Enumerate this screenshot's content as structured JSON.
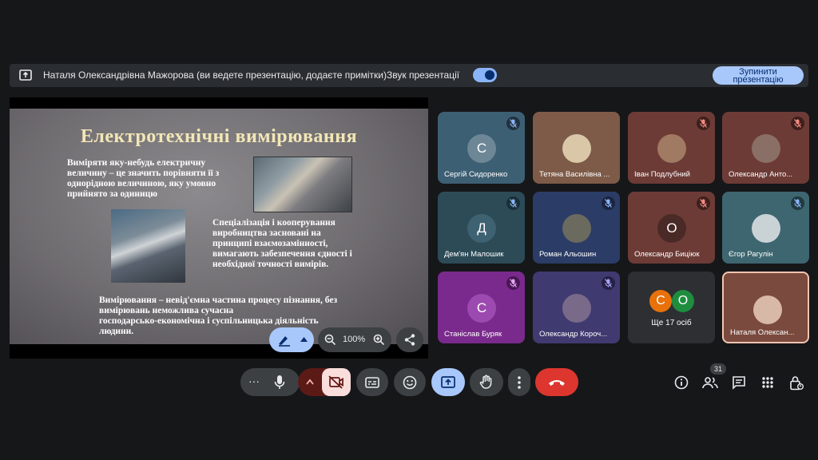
{
  "presenting_bar": {
    "text": "Наталя Олександрівна Мажорова (ви ведете презентацію, додаєте примітки)",
    "audio_label": "Звук презентації",
    "stop_line1": "Зупинити",
    "stop_line2": "презентацію"
  },
  "slide": {
    "title": "Електротехнічні вимірювання",
    "p1": [
      "Виміряти яку-небудь електричну",
      "величину – це значить порівняти її з",
      "однорідною величиною, яку умовно",
      "прийнято за одиницю"
    ],
    "p2": [
      "Спеціалізація і кооперування",
      "виробництва засновані на",
      "принципі взаємозамінності,",
      "вимагають забезпечення єдності і",
      "необхідної точності вимірів."
    ],
    "p3": [
      "Вимірювання – невід'ємна частина процесу пізнання, без",
      "вимірювань неможлива сучасна",
      "господарсько-економічна і суспільницька діяльність",
      "людини."
    ]
  },
  "slide_controls": {
    "zoom": "100%"
  },
  "participants": [
    {
      "name": "Сергій Сидоренко",
      "initial": "С",
      "bg": "#3d5f73",
      "avatar": "#6d8796",
      "mute_bg": "#20323d",
      "mute_color": "#8ab4f8",
      "photo": false
    },
    {
      "name": "Тетяна Василівна ...",
      "initial": "",
      "bg": "#7d5b48",
      "avatar": "#d9c7a8",
      "mute_bg": "",
      "mute_color": "",
      "photo": true
    },
    {
      "name": "Іван Подлубний",
      "initial": "",
      "bg": "#6d3b36",
      "avatar": "#a07a62",
      "mute_bg": "#3e1f1c",
      "mute_color": "#f28b82",
      "photo": true
    },
    {
      "name": "Олександр Анто...",
      "initial": "",
      "bg": "#6d3b36",
      "avatar": "#8a6f66",
      "mute_bg": "#3e1f1c",
      "mute_color": "#f28b82",
      "photo": true
    },
    {
      "name": "Дем'ян Малошик",
      "initial": "Д",
      "bg": "#2c4b57",
      "avatar": "#3e6272",
      "mute_bg": "#1b2f37",
      "mute_color": "#8ab4f8",
      "photo": false
    },
    {
      "name": "Роман Альошин",
      "initial": "",
      "bg": "#2b3c66",
      "avatar": "#6a6a5f",
      "mute_bg": "#1b2540",
      "mute_color": "#8ab4f8",
      "photo": true
    },
    {
      "name": "Олександр Биціюк",
      "initial": "О",
      "bg": "#6d3b36",
      "avatar": "#4a2a26",
      "mute_bg": "#3e1f1c",
      "mute_color": "#f28b82",
      "photo": false
    },
    {
      "name": "Єгор Рагулін",
      "initial": "",
      "bg": "#3d6670",
      "avatar": "#c9d3d6",
      "mute_bg": "#203a40",
      "mute_color": "#8ab4f8",
      "photo": true
    },
    {
      "name": "Станіслав Буряк",
      "initial": "С",
      "bg": "#7a2a8c",
      "avatar": "#9c4aaf",
      "mute_bg": "#4a1656",
      "mute_color": "#e2a6f0",
      "photo": false
    },
    {
      "name": "Олександр Короч...",
      "initial": "",
      "bg": "#3f3a70",
      "avatar": "#7a6a8a",
      "mute_bg": "#252146",
      "mute_color": "#a8a3f5",
      "photo": true
    },
    {
      "name": "Ще 17 осіб",
      "initial": "",
      "bg": "#2d2f33",
      "avatar": "",
      "mute_bg": "",
      "mute_color": "",
      "photo": false
    },
    {
      "name": "Наталя Олексан...",
      "initial": "",
      "bg": "#7a4a3e",
      "avatar": "#d8b8a6",
      "mute_bg": "",
      "mute_color": "",
      "photo": true
    }
  ],
  "more_others": {
    "label": "Ще 17 осіб",
    "chip1": "С",
    "chip1_color": "#e8710a",
    "chip2": "O",
    "chip2_color": "#1e8e3e"
  },
  "toolbar": {
    "more": "···"
  },
  "right_controls": {
    "people_count": "31"
  }
}
